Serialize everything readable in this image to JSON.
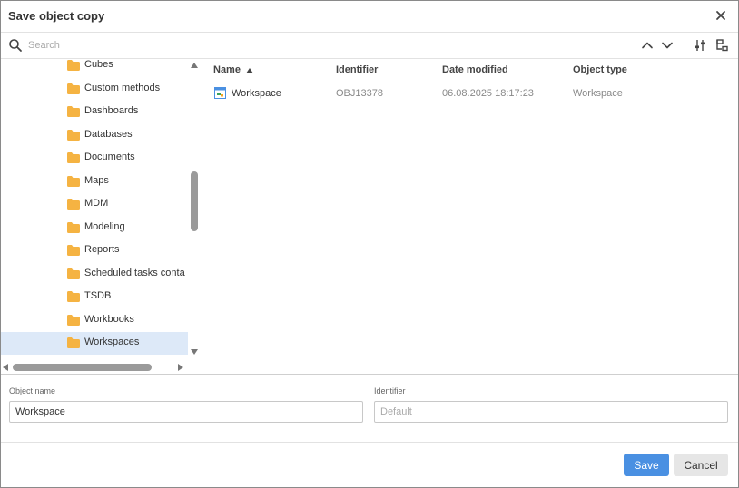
{
  "dialog": {
    "title": "Save object copy"
  },
  "search": {
    "placeholder": "Search"
  },
  "tree": {
    "items": [
      {
        "label": "Cubes"
      },
      {
        "label": "Custom methods"
      },
      {
        "label": "Dashboards"
      },
      {
        "label": "Databases"
      },
      {
        "label": "Documents"
      },
      {
        "label": "Maps"
      },
      {
        "label": "MDM"
      },
      {
        "label": "Modeling"
      },
      {
        "label": "Reports"
      },
      {
        "label": "Scheduled tasks conta"
      },
      {
        "label": "TSDB"
      },
      {
        "label": "Workbooks"
      },
      {
        "label": "Workspaces",
        "selected": true
      }
    ]
  },
  "grid": {
    "columns": {
      "name": "Name",
      "identifier": "Identifier",
      "date_modified": "Date modified",
      "object_type": "Object type"
    },
    "sort": {
      "column": "Name",
      "direction": "ascending"
    },
    "rows": [
      {
        "name": "Workspace",
        "identifier": "OBJ13378",
        "date_modified": "06.08.2025 18:17:23",
        "object_type": "Workspace"
      }
    ]
  },
  "form": {
    "object_name_label": "Object name",
    "object_name_value": "Workspace",
    "identifier_label": "Identifier",
    "identifier_placeholder": "Default"
  },
  "buttons": {
    "save": "Save",
    "cancel": "Cancel"
  },
  "icons": {
    "close": "close-icon",
    "search": "search-icon",
    "up": "chevron-up-icon",
    "down": "chevron-down-icon",
    "filter": "filter-settings-icon",
    "folder_tree": "folder-tree-icon",
    "folder": "folder-icon",
    "workspace": "workspace-icon"
  },
  "colors": {
    "accent": "#4a90e2",
    "folder": "#f5b342",
    "selected_row": "#dde9f8"
  }
}
